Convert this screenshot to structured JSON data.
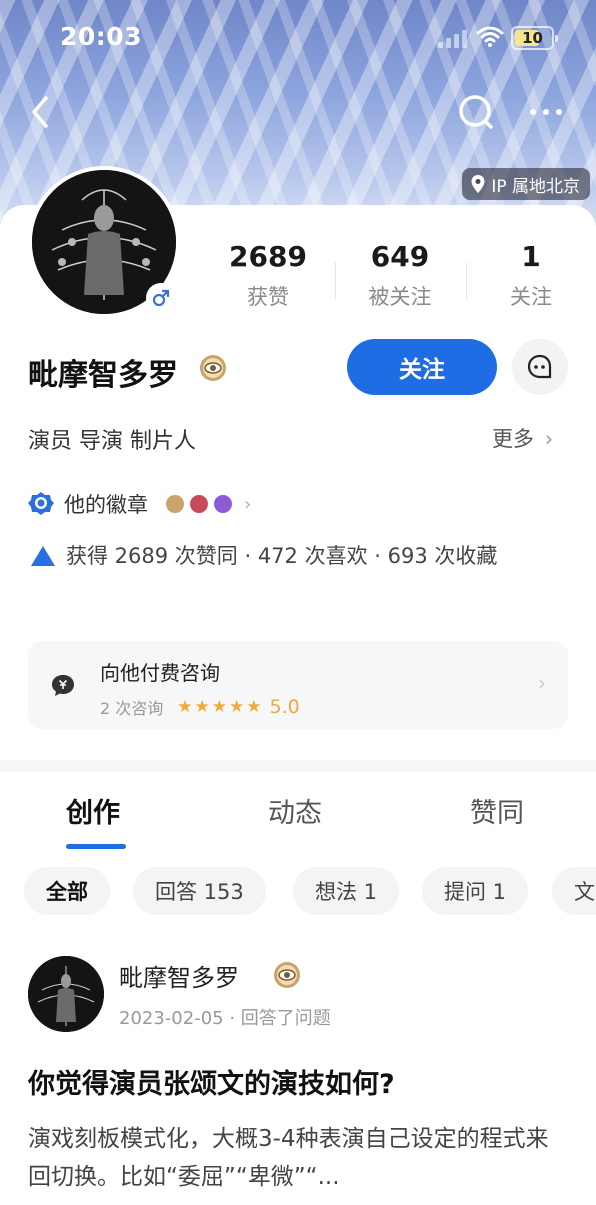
{
  "status_bar": {
    "time": "20:03",
    "battery": "10"
  },
  "header": {
    "ip_label": "IP 属地北京"
  },
  "profile": {
    "name": "毗摩智多罗",
    "stats": [
      {
        "value": "2689",
        "label": "获赞"
      },
      {
        "value": "649",
        "label": "被关注"
      },
      {
        "value": "1",
        "label": "关注"
      }
    ],
    "follow_label": "关注",
    "roles": "演员 导演 制片人",
    "more_label": "更多",
    "badges_label": "他的徽章",
    "achievements": "获得 2689 次赞同 · 472 次喜欢 · 693 次收藏"
  },
  "consult": {
    "title": "向他付费咨询",
    "count": "2 次咨询",
    "stars": "★★★★★",
    "rating": "5.0"
  },
  "tabs": [
    "创作",
    "动态",
    "赞同"
  ],
  "chips": [
    "全部",
    "回答 153",
    "想法 1",
    "提问 1",
    "文"
  ],
  "post": {
    "author": "毗摩智多罗",
    "date": "2023-02-05",
    "action": "回答了问题",
    "title": "你觉得演员张颂文的演技如何?",
    "excerpt": "演戏刻板模式化，大概3-4种表演自己设定的程式来回切换。比如“委屈”“卑微”“..."
  },
  "colors": {
    "accent": "#1f6de4",
    "star": "#f0a93a",
    "badge_gold": "#c8a46a",
    "badge_red": "#c94b5b",
    "badge_purple": "#8e5bd6"
  }
}
